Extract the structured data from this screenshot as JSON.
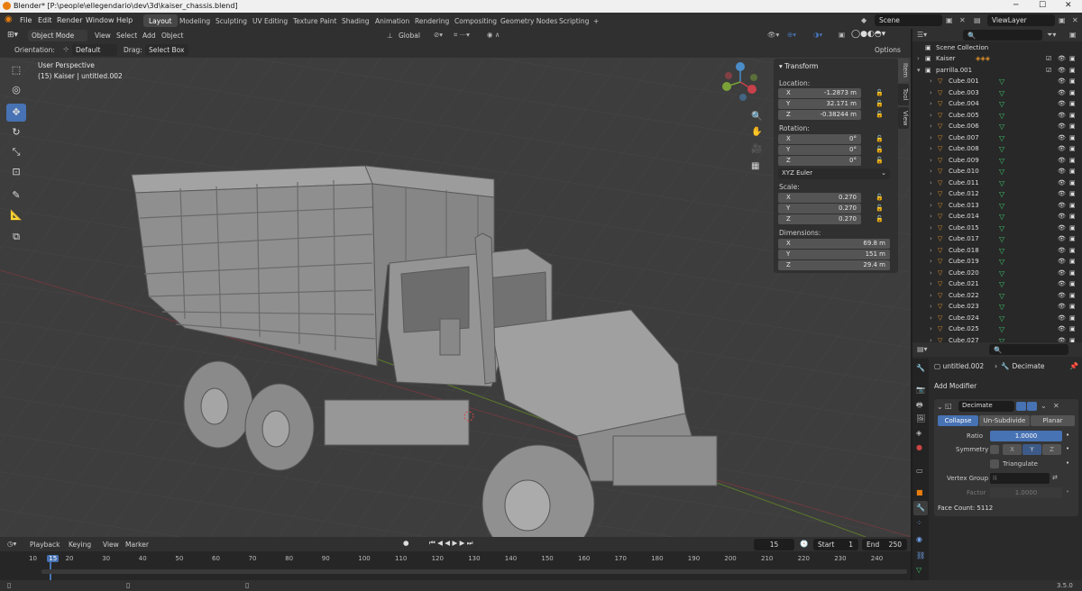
{
  "window": {
    "title": "Blender* [P:\\people\\ellegendario\\dev\\3d\\kaiser_chassis.blend]",
    "minimize": "─",
    "maximize": "☐",
    "close": "✕"
  },
  "menu": {
    "file": "File",
    "edit": "Edit",
    "render": "Render",
    "window": "Window",
    "help": "Help"
  },
  "workspaces": [
    "Layout",
    "Modeling",
    "Sculpting",
    "UV Editing",
    "Texture Paint",
    "Shading",
    "Animation",
    "Rendering",
    "Compositing",
    "Geometry Nodes",
    "Scripting",
    "+"
  ],
  "scene": {
    "label": "Scene",
    "view_layer": "ViewLayer"
  },
  "header": {
    "mode": "Object Mode",
    "view": "View",
    "select": "Select",
    "add": "Add",
    "object": "Object",
    "transform_orientation": "Global"
  },
  "toolsettings": {
    "orientation_label": "Orientation:",
    "orientation_value": "Default",
    "drag_label": "Drag:",
    "drag_value": "Select Box",
    "options": "Options"
  },
  "viewport": {
    "perspective": "User Perspective",
    "object_info": "(15) Kaiser | untitled.002"
  },
  "npanel": {
    "title": "Transform",
    "tabs": [
      "Item",
      "Tool",
      "View"
    ],
    "location_label": "Location:",
    "location": [
      {
        "axis": "X",
        "value": "-1.2873 m"
      },
      {
        "axis": "Y",
        "value": "32.171 m"
      },
      {
        "axis": "Z",
        "value": "-0.38244 m"
      }
    ],
    "rotation_label": "Rotation:",
    "rotation": [
      {
        "axis": "X",
        "value": "0°"
      },
      {
        "axis": "Y",
        "value": "0°"
      },
      {
        "axis": "Z",
        "value": "0°"
      }
    ],
    "rotation_mode": "XYZ Euler",
    "scale_label": "Scale:",
    "scale": [
      {
        "axis": "X",
        "value": "0.270"
      },
      {
        "axis": "Y",
        "value": "0.270"
      },
      {
        "axis": "Z",
        "value": "0.270"
      }
    ],
    "dimensions_label": "Dimensions:",
    "dimensions": [
      {
        "axis": "X",
        "value": "69.8 m"
      },
      {
        "axis": "Y",
        "value": "151 m"
      },
      {
        "axis": "Z",
        "value": "29.4 m"
      }
    ]
  },
  "outliner": {
    "root": "Scene Collection",
    "rows": [
      "Kaiser",
      "parrilla.001",
      "Cube.001",
      "Cube.003",
      "Cube.004",
      "Cube.005",
      "Cube.006",
      "Cube.007",
      "Cube.008",
      "Cube.009",
      "Cube.010",
      "Cube.011",
      "Cube.012",
      "Cube.013",
      "Cube.014",
      "Cube.015",
      "Cube.017",
      "Cube.018",
      "Cube.019",
      "Cube.020",
      "Cube.021",
      "Cube.022",
      "Cube.023",
      "Cube.024",
      "Cube.025",
      "Cube.027"
    ]
  },
  "properties": {
    "object_name": "untitled.002",
    "modifier_breadcrumb": "Decimate",
    "add_modifier": "Add Modifier",
    "modifier_name": "Decimate",
    "modes": [
      "Collapse",
      "Un-Subdivide",
      "Planar"
    ],
    "ratio_label": "Ratio",
    "ratio_value": "1.0000",
    "symmetry_label": "Symmetry",
    "sym_axes": [
      "X",
      "Y",
      "Z"
    ],
    "triangulate_label": "Triangulate",
    "vertex_group_label": "Vertex Group",
    "factor_label": "Factor",
    "factor_value": "1.0000",
    "face_count": "Face Count: 5112"
  },
  "timeline": {
    "playback": "Playback",
    "keying": "Keying",
    "view": "View",
    "marker": "Marker",
    "current_frame": "15",
    "start_label": "Start",
    "start_value": "1",
    "end_label": "End",
    "end_value": "250",
    "ticks": [
      "10",
      "15",
      "20",
      "30",
      "40",
      "50",
      "60",
      "70",
      "80",
      "90",
      "100",
      "110",
      "120",
      "130",
      "140",
      "150",
      "160",
      "170",
      "180",
      "190",
      "200",
      "210",
      "220",
      "230",
      "240"
    ]
  },
  "status": {
    "version": "3.5.0"
  },
  "colors": {
    "accent": "#4772b3",
    "header": "#303030",
    "viewport": "#3d3d3d",
    "orange": "#e87d0d"
  }
}
